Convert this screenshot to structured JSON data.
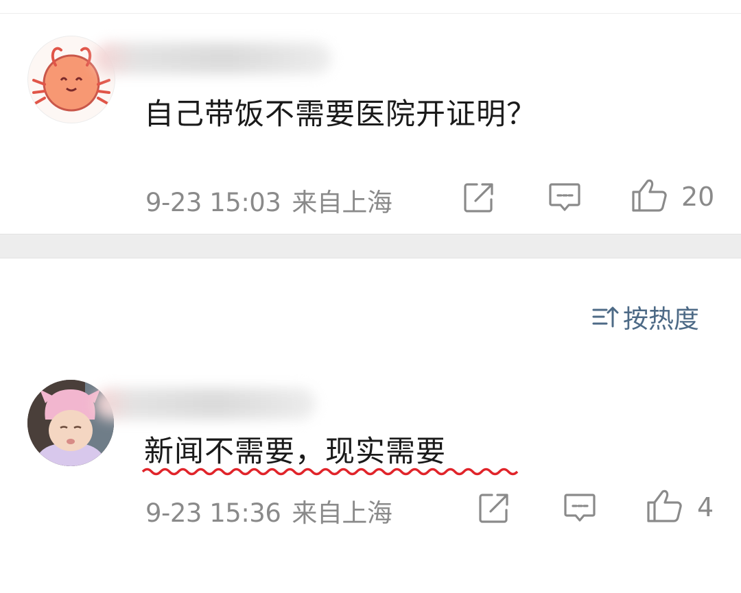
{
  "comments": [
    {
      "avatar_icon": "crab-avatar",
      "text": "自己带饭不需要医院开证明？",
      "time": "9-23 15:03",
      "location": "来自上海",
      "likes": "20"
    },
    {
      "avatar_icon": "baby-avatar",
      "text": "新闻不需要，现实需要",
      "time": "9-23 15:36",
      "location": "来自上海",
      "likes": "4"
    }
  ],
  "sort": {
    "label": "按热度",
    "icon": "sort-icon"
  },
  "colors": {
    "accent": "#4d6a86",
    "meta": "#8a8a8a",
    "underline": "#e0242a"
  }
}
